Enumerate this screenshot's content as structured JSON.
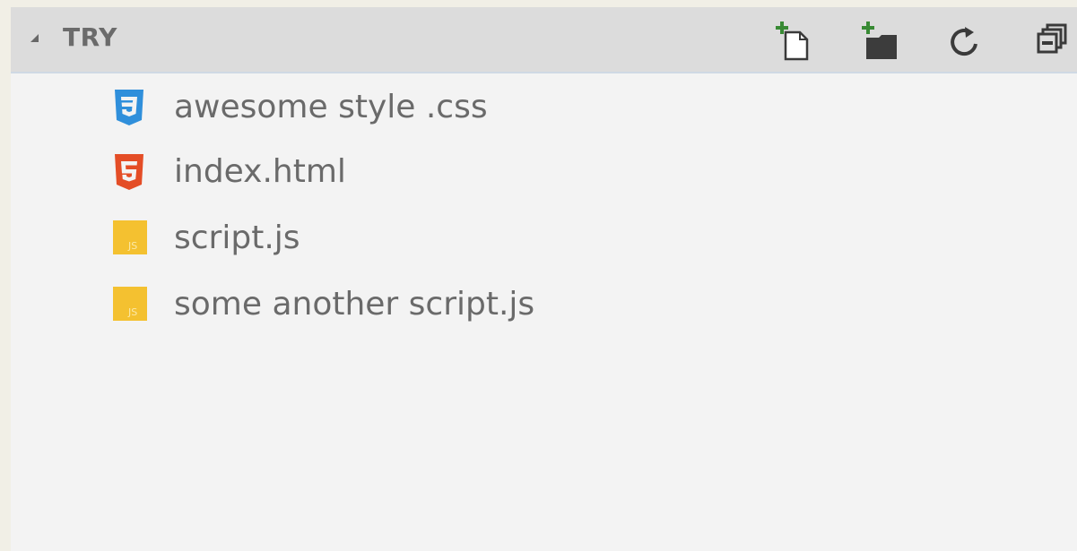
{
  "explorer": {
    "folder_name": "TRY",
    "actions": [
      {
        "name": "new-file-icon",
        "label": "New File"
      },
      {
        "name": "new-folder-icon",
        "label": "New Folder"
      },
      {
        "name": "refresh-icon",
        "label": "Refresh"
      },
      {
        "name": "collapse-all-icon",
        "label": "Collapse All"
      }
    ],
    "files": [
      {
        "label": "awesome style .css",
        "icon": "css3-icon",
        "color": "#2f8fdb"
      },
      {
        "label": "index.html",
        "icon": "html5-icon",
        "color": "#e44d26"
      },
      {
        "label": "script.js",
        "icon": "js-icon",
        "color": "#f4c130"
      },
      {
        "label": "some another script.js",
        "icon": "js-icon",
        "color": "#f4c130"
      }
    ]
  }
}
